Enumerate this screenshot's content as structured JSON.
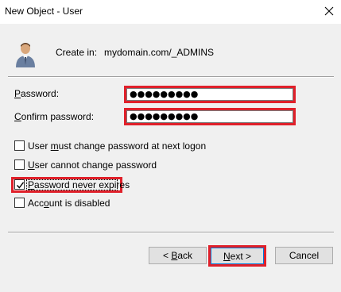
{
  "window": {
    "title": "New Object - User",
    "close_glyph": "close-icon"
  },
  "header": {
    "create_in_label": "Create in:",
    "create_in_path": "mydomain.com/_ADMINS",
    "avatar_icon": "user-avatar-icon"
  },
  "fields": {
    "password_label_underlined": "P",
    "password_label_rest": "assword:",
    "password_value": "●●●●●●●●●",
    "confirm_label_underlined": "C",
    "confirm_label_rest": "onfirm password:",
    "confirm_value": "●●●●●●●●●"
  },
  "options": [
    {
      "pre": "User ",
      "underlined": "m",
      "post": "ust change password at next logon",
      "checked": false
    },
    {
      "pre": "U",
      "underlined": "s",
      "post": "er cannot change password",
      "checked": false,
      "underline_first": true
    },
    {
      "pre": "",
      "underlined": "P",
      "post": "assword never expires",
      "checked": true
    },
    {
      "pre": "Acc",
      "underlined": "o",
      "post": "unt is disabled",
      "checked": false
    }
  ],
  "buttons": {
    "back_lt": "< ",
    "back_underlined": "B",
    "back_rest": "ack",
    "next_underlined": "N",
    "next_rest": "ext >",
    "cancel": "Cancel"
  },
  "colors": {
    "highlight": "#e0202a",
    "dialog_bg": "#f0f0f0"
  }
}
